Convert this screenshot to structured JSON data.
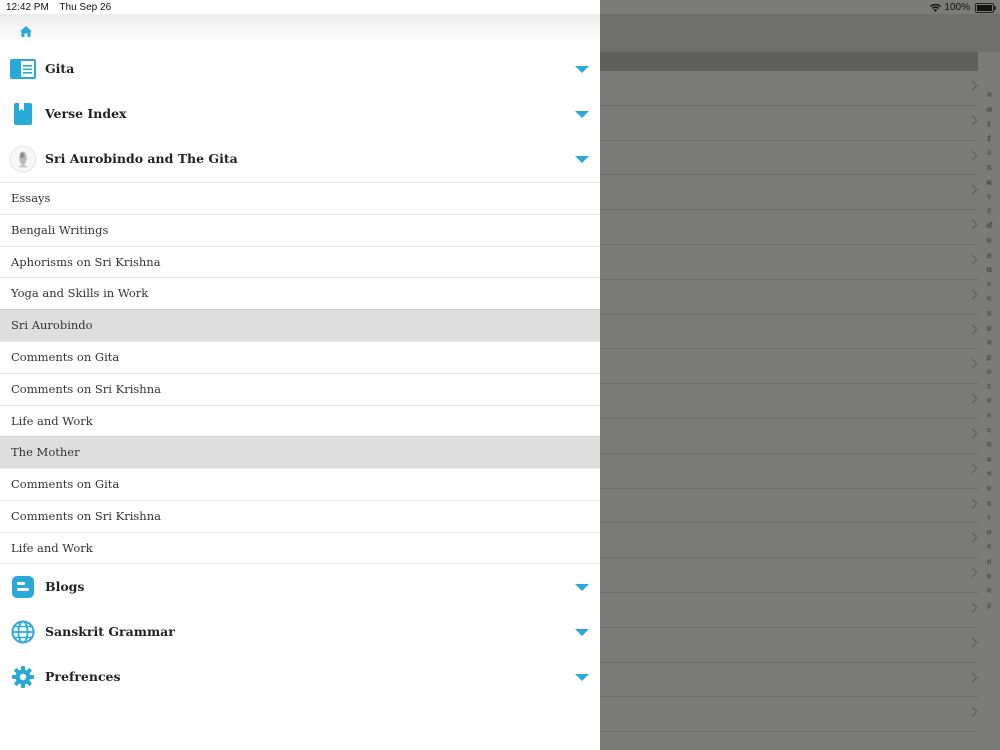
{
  "status": {
    "time": "12:42 PM",
    "date": "Thu Sep 26",
    "battery": "100%"
  },
  "sections": {
    "gita": "Gita",
    "verse_index": "Verse Index",
    "aurobindo": "Sri Aurobindo and The Gita",
    "blogs": "Blogs",
    "grammar": "Sanskrit Grammar",
    "preferences": "Prefrences"
  },
  "submenu": [
    "Essays",
    "Bengali Writings",
    "Aphorisms on Sri Krishna",
    "Yoga and Skills in Work",
    "Sri Aurobindo",
    "Comments on Gita",
    "Comments on Sri Krishna",
    "Life and Work",
    "The Mother",
    "Comments on Gita",
    "Comments on Sri Krishna",
    "Life and Work"
  ],
  "index_letters": [
    "अ",
    "आ",
    "इ",
    "ई",
    "उ",
    "ऊ",
    "ऋ",
    "ए",
    "ऐ",
    "औ",
    "क",
    "क्ष",
    "ख",
    "ग",
    "घ",
    "च",
    "छ",
    "ज",
    "झ",
    "त",
    "द",
    "ध",
    "न",
    "प",
    "फ",
    "ब",
    "भ",
    "म",
    "य",
    "र",
    "ल",
    "व",
    "श",
    "ष",
    "स",
    "ह"
  ],
  "colors": {
    "accent": "#29a9d8",
    "highlight": "#dedede",
    "overlay": "#7b7b79"
  }
}
